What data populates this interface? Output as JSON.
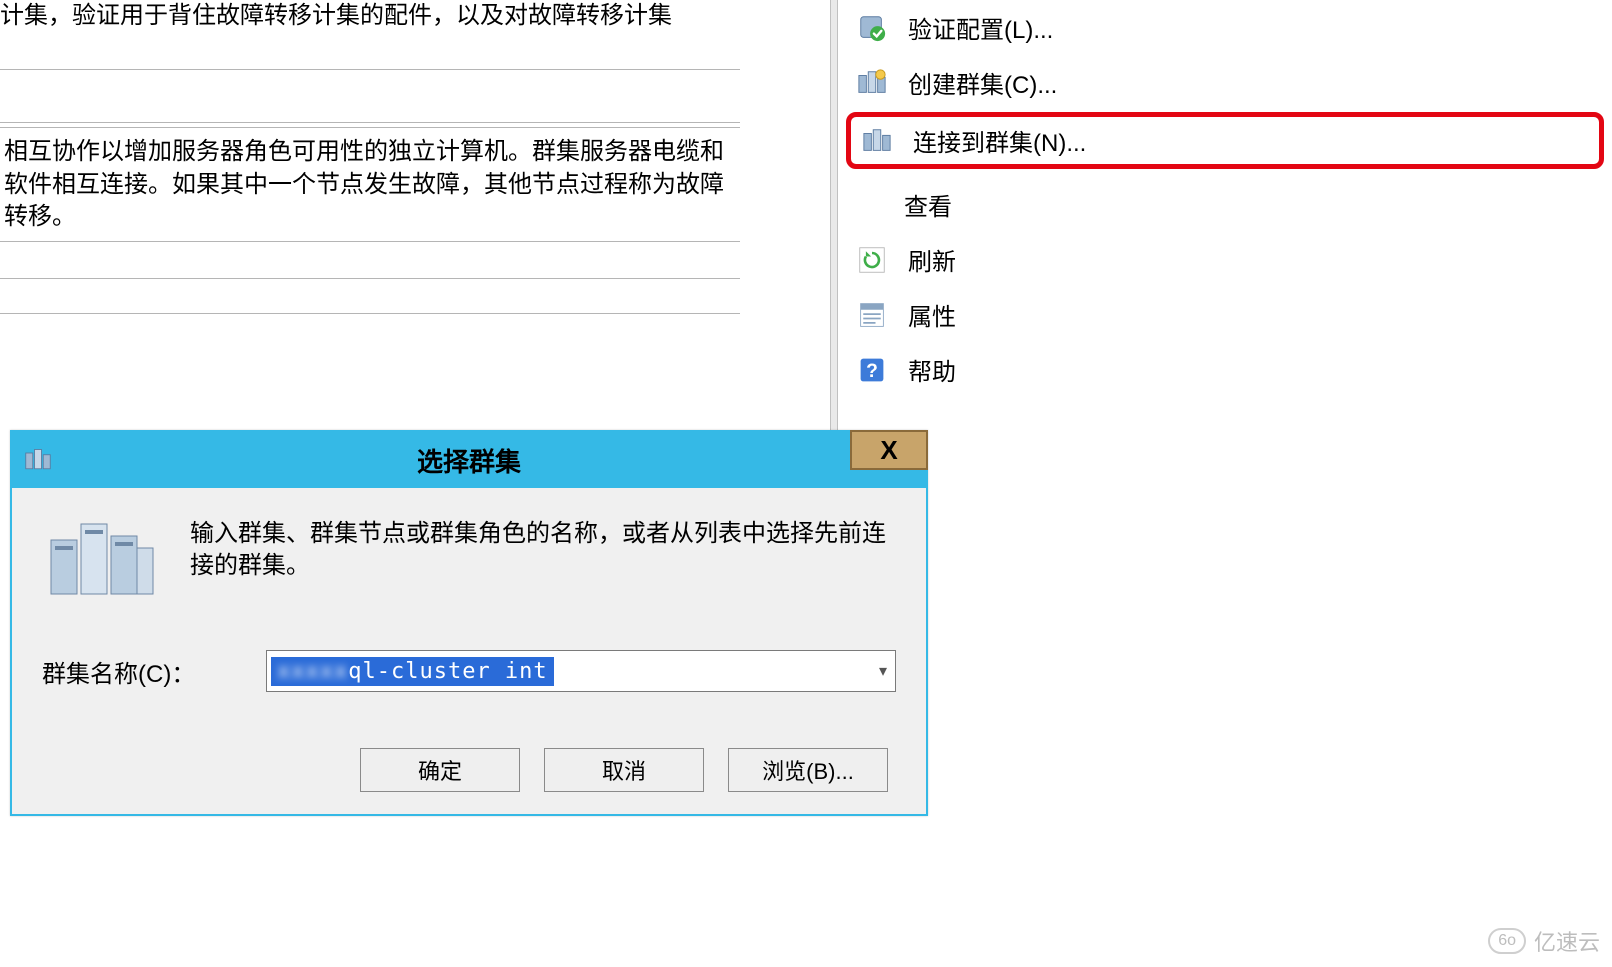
{
  "main": {
    "top_text_partial": "计集，验证用于背住故障转移计集的配件，以及对故障转移计集",
    "description": "相互协作以增加服务器角色可用性的独立计算机。群集服务器电缆和软件相互连接。如果其中一个节点发生故障，其他节点过程称为故障转移。"
  },
  "actions": {
    "validate": "验证配置(L)...",
    "create": "创建群集(C)...",
    "connect": "连接到群集(N)...",
    "view": "查看",
    "refresh": "刷新",
    "properties": "属性",
    "help": "帮助"
  },
  "dialog": {
    "title": "选择群集",
    "close_glyph": "X",
    "instructions": "输入群集、群集节点或群集角色的名称，或者从列表中选择先前连接的群集。",
    "cluster_name_label": "群集名称(C)：",
    "cluster_name_value": "ql-cluster        int",
    "ok": "确定",
    "cancel": "取消",
    "browse": "浏览(B)..."
  },
  "watermark": {
    "badge": "6o",
    "text": "亿速云"
  }
}
